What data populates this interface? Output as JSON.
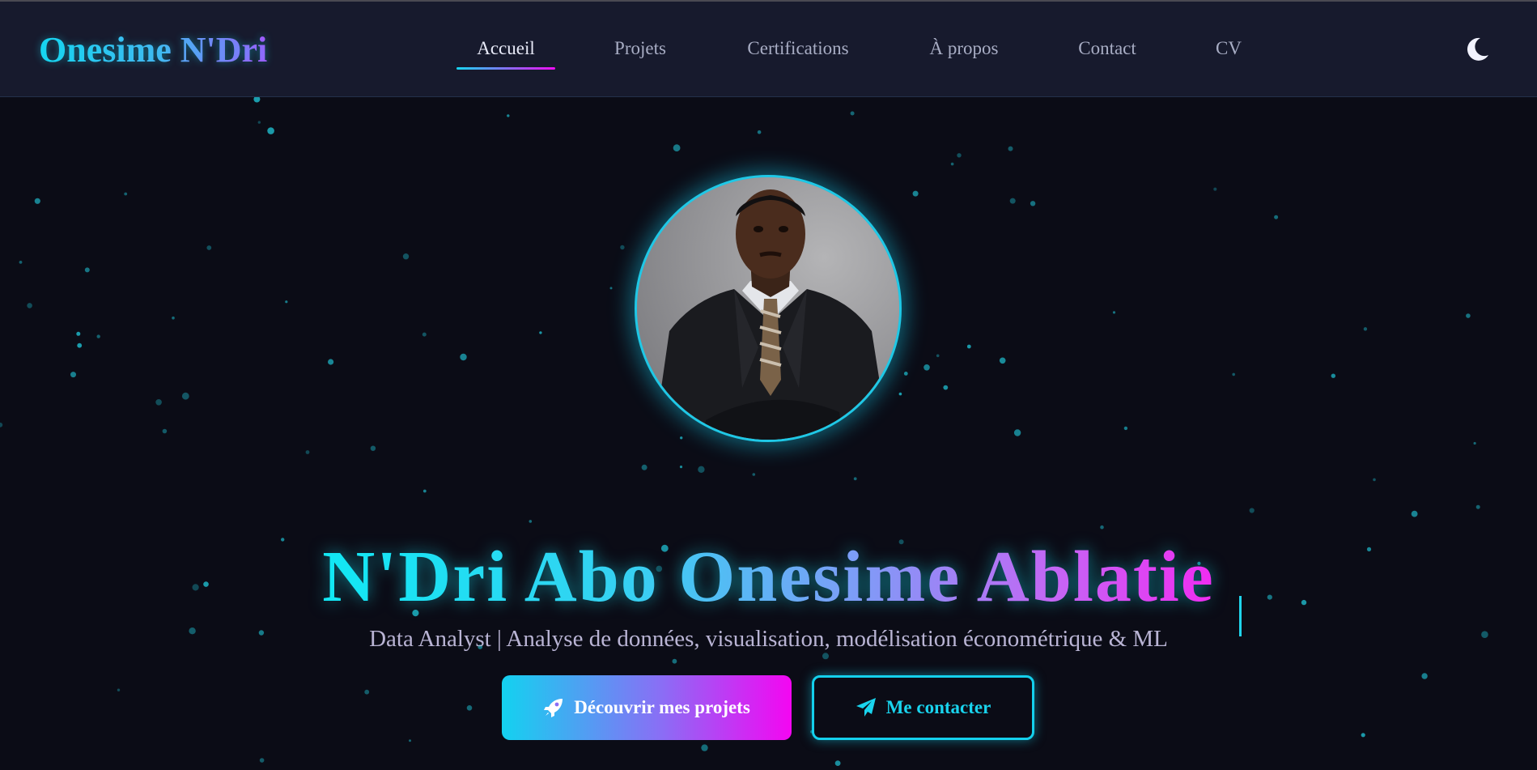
{
  "nav": {
    "brand": "Onesime N'Dri",
    "links": [
      {
        "label": "Accueil",
        "active": true
      },
      {
        "label": "Projets",
        "active": false
      },
      {
        "label": "Certifications",
        "active": false
      },
      {
        "label": "À propos",
        "active": false
      },
      {
        "label": "Contact",
        "active": false
      },
      {
        "label": "CV",
        "active": false
      }
    ],
    "theme_icon": "moon-icon"
  },
  "hero": {
    "avatar_icon": "profile-photo",
    "name": "N'Dri Abo Onesime Ablatie",
    "tagline": "Data Analyst | Analyse de données, visualisation, modélisation économétrique & ML",
    "buttons": {
      "primary": {
        "label": "Découvrir mes projets",
        "icon": "rocket-icon"
      },
      "secondary": {
        "label": "Me contacter",
        "icon": "paper-plane-icon"
      }
    }
  },
  "colors": {
    "background": "#0b0c16",
    "navbar": "#171a2d",
    "accent_cyan": "#16d6f0",
    "accent_magenta": "#f00cf5",
    "text_muted": "#a8adc4"
  }
}
